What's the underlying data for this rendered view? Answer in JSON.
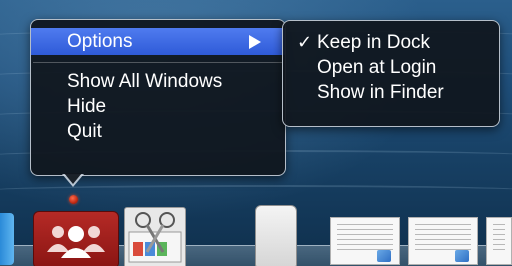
{
  "context_menu": {
    "items": [
      {
        "label": "Options",
        "highlighted": true,
        "has_submenu": true
      },
      {
        "label": "Show All Windows"
      },
      {
        "label": "Hide"
      },
      {
        "label": "Quit"
      }
    ]
  },
  "options_submenu": {
    "items": [
      {
        "label": "Keep in Dock",
        "checked": true
      },
      {
        "label": "Open at Login",
        "checked": false
      },
      {
        "label": "Show in Finder",
        "checked": false
      }
    ],
    "check_glyph": "✓"
  },
  "dock": {
    "icons": [
      {
        "name": "partial-app-icon"
      },
      {
        "name": "people-icon",
        "running": true
      },
      {
        "name": "scissors-icon"
      },
      {
        "name": "pages-icon"
      },
      {
        "name": "document-thumbnail"
      },
      {
        "name": "document-thumbnail"
      },
      {
        "name": "document-thumbnail"
      }
    ]
  },
  "colors": {
    "highlight": "#3a66e0",
    "menu_bg": "#10161e",
    "running_indicator": "#d4321a",
    "app_icon_red": "#a1201d"
  }
}
